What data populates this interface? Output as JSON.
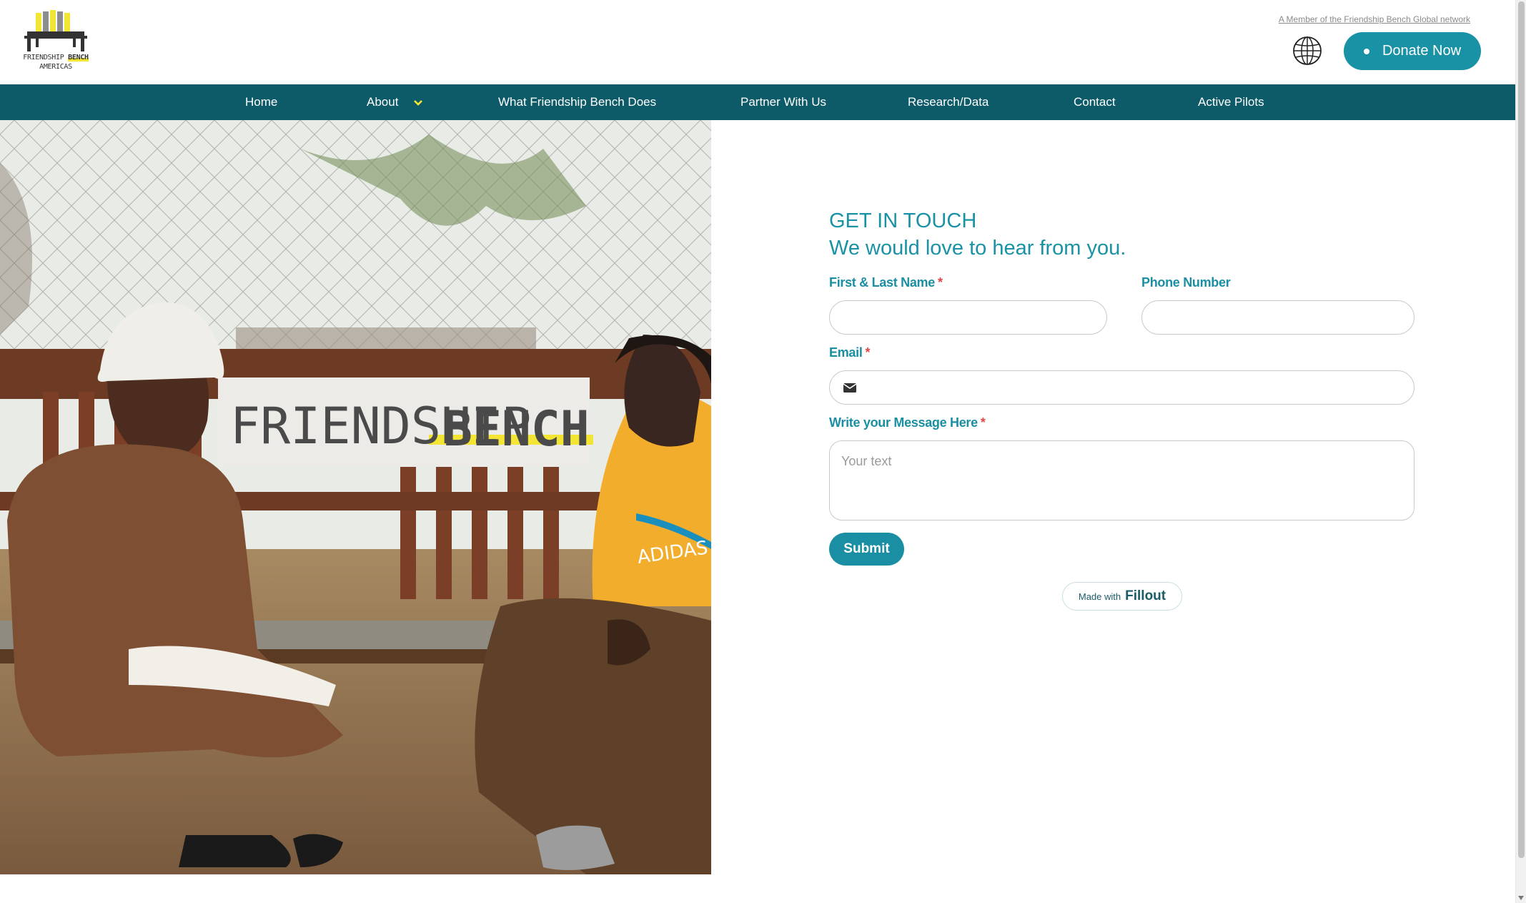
{
  "header": {
    "logo": {
      "line1": "FRIENDSHIP",
      "line1b": "BENCH",
      "line2": "AMERICAS"
    },
    "network_link": "A Member of the Friendship Bench Global network",
    "donate_label": "Donate Now"
  },
  "nav": {
    "items": [
      {
        "label": "Home"
      },
      {
        "label": "About"
      },
      {
        "label": "What Friendship Bench Does"
      },
      {
        "label": "Partner With Us"
      },
      {
        "label": "Research/Data"
      },
      {
        "label": "Contact"
      },
      {
        "label": "Active Pilots"
      }
    ]
  },
  "photo": {
    "sign_left": "FRIENDSHIP",
    "sign_right": "BENCH",
    "shirt_text": "ADIDAS"
  },
  "form": {
    "title": "GET IN TOUCH",
    "subtitle": "We would love to hear from you.",
    "name_label": "First & Last Name",
    "phone_label": "Phone Number",
    "email_label": "Email",
    "message_label": "Write your Message Here",
    "message_placeholder": "Your text",
    "required_mark": "*",
    "submit_label": "Submit",
    "made_with": "Made with",
    "made_with_brand": "Fillout"
  },
  "colors": {
    "teal": "#1a92a6",
    "nav": "#0d5a69",
    "accent_yellow": "#f3e534",
    "required": "#e04848"
  }
}
